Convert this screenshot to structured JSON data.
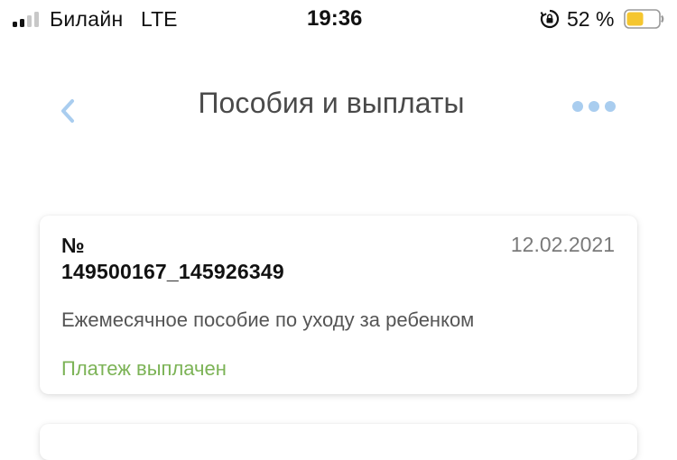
{
  "status_bar": {
    "carrier": "Билайн",
    "network": "LTE",
    "time": "19:36",
    "battery_percent": "52 %",
    "signal_strength": 2,
    "icons": [
      "signal-icon",
      "rotation-lock-icon",
      "battery-icon"
    ]
  },
  "nav": {
    "title": "Пособия и выплаты",
    "icons": [
      "back-chevron-icon",
      "more-dots-icon"
    ],
    "accent_color": "#a9cdef"
  },
  "payments": [
    {
      "number_label": "№",
      "number": "149500167_145926349",
      "date": "12.02.2021",
      "description": "Ежемесячное пособие по уходу за ребенком",
      "status": "Платеж выплачен",
      "status_color": "#7cb356"
    }
  ]
}
